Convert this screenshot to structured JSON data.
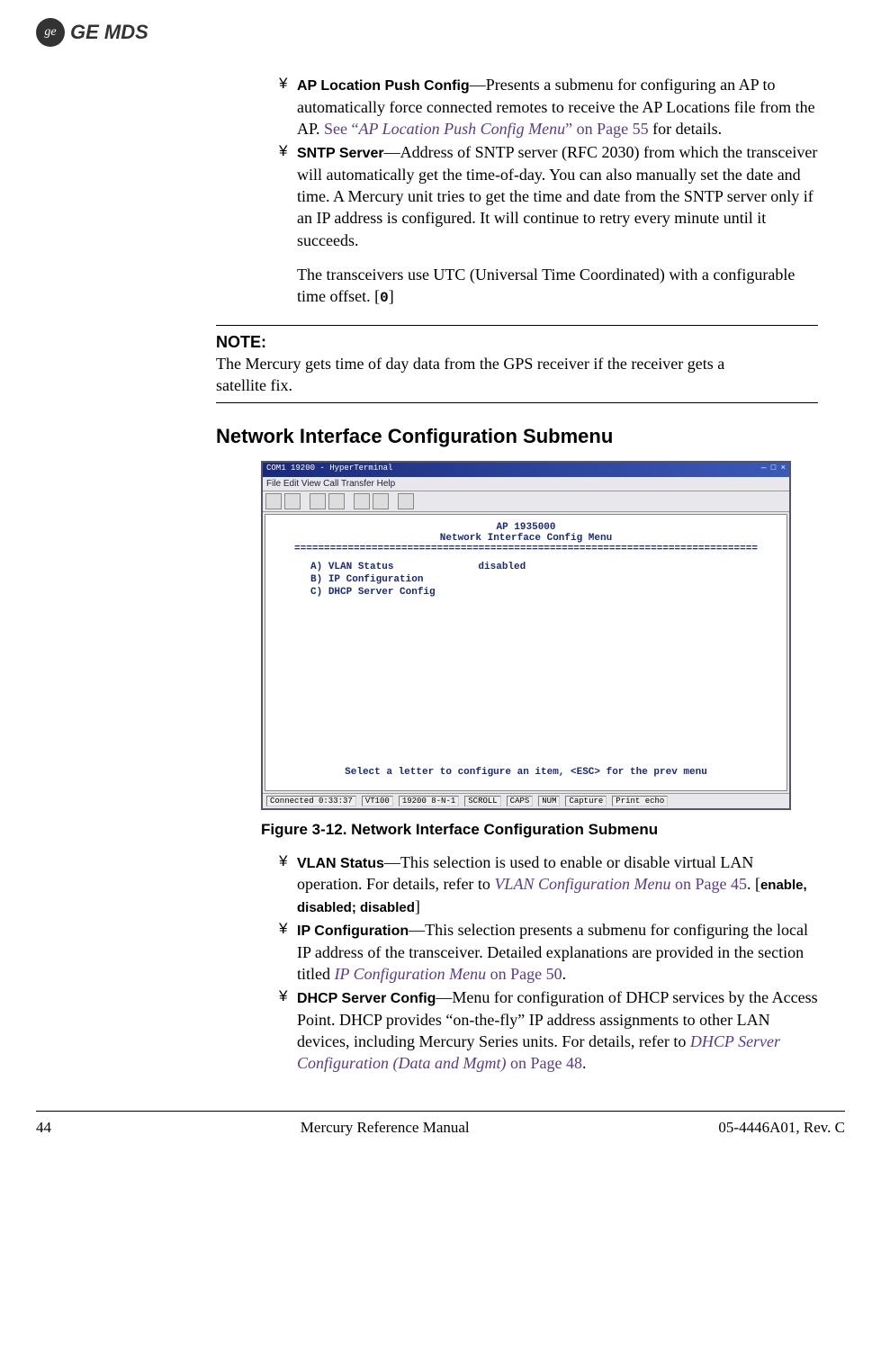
{
  "brand": {
    "logo_text": "ge",
    "name": "GE MDS"
  },
  "items_top": [
    {
      "marker": "¥",
      "label": "AP Location Push Config",
      "text_before": "—Presents a submenu for configuring an AP to automatically force connected remotes to receive the AP Locations file from the AP. ",
      "link_prefix": "See “",
      "link_text": "AP Location Push Config Menu",
      "link_suffix": "” on Page 55",
      "text_after": " for details."
    },
    {
      "marker": "¥",
      "label": "SNTP Server",
      "text_before": "—Address of SNTP server (RFC 2030) from which the transceiver will automatically get the time-of-day. You can also manually set the date and time. A Mercury unit tries to get the time and date from the SNTP server only if an IP address is configured. It will continue to retry every minute until it succeeds.",
      "para2": "The transceivers use UTC (Universal Time Coordinated) with a configurable time offset. [",
      "mono": "0",
      "para2_close": "]"
    }
  ],
  "note": {
    "label": "NOTE:",
    "text": "The Mercury gets time of day data from the GPS receiver if the receiver gets a satellite fix."
  },
  "heading": "Network Interface Configuration Submenu",
  "terminal": {
    "title": "COM1 19200 - HyperTerminal",
    "menu": "File  Edit  View  Call  Transfer  Help",
    "banner_top": "AP 1935000",
    "banner": "Network Interface Config Menu",
    "rows": {
      "a_key": "A)",
      "a_label": "VLAN Status",
      "a_val": "disabled",
      "b_key": "B)",
      "b_label": "IP Configuration",
      "c_key": "C)",
      "c_label": "DHCP Server Config"
    },
    "footer": "Select a letter to configure an item, <ESC> for the prev menu",
    "status": {
      "conn": "Connected 0:33:37",
      "term": "VT100",
      "baud": "19200 8-N-1",
      "s1": "SCROLL",
      "s2": "CAPS",
      "s3": "NUM",
      "s4": "Capture",
      "s5": "Print echo"
    }
  },
  "figure_caption": "Figure 3-12. Network Interface Configuration Submenu",
  "items_bottom": {
    "b1": {
      "marker": "¥",
      "label": "VLAN Status",
      "t1": "—This selection is used to enable or disable virtual LAN operation. For details, refer to ",
      "link": "VLAN Configuration Menu",
      "t2": " on Page 45",
      "t3": ". [",
      "opts": "enable, disabled; disabled",
      "t4": "]"
    },
    "b2": {
      "marker": "¥",
      "label": "IP Configuration",
      "t1": "—This selection presents a submenu for configuring the local IP address of the transceiver. Detailed explanations are provided in the section titled ",
      "link": "IP Configuration Menu",
      "t2": " on Page 50",
      "t3": "."
    },
    "b3": {
      "marker": "¥",
      "label": "DHCP Server Config",
      "t1": "—Menu for configuration of DHCP services by the Access Point. DHCP provides “on-the-fly” IP address assignments to other LAN devices, including Mercury Series units. For details, refer to ",
      "link": "DHCP Server Configuration (Data and Mgmt)",
      "t2": " on Page 48",
      "t3": "."
    }
  },
  "footer": {
    "left": "44",
    "center": "Mercury Reference Manual",
    "right": "05-4446A01, Rev. C"
  }
}
